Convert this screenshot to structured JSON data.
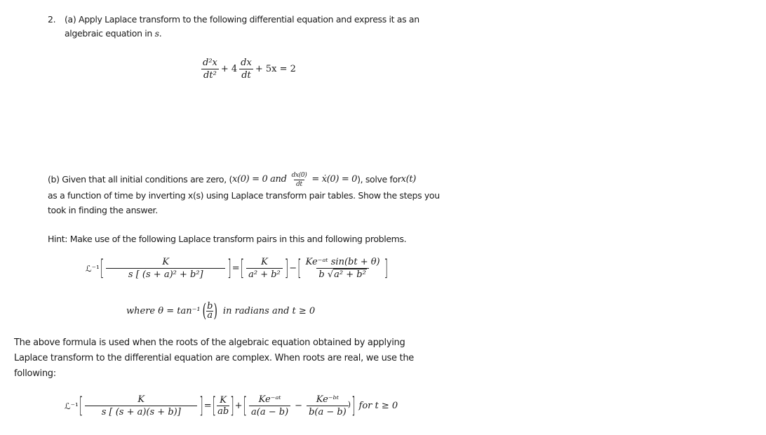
{
  "question": {
    "number": "2.",
    "part_a": {
      "line1": "(a) Apply Laplace transform to the following differential equation and express it as an",
      "line2_prefix": "algebraic equation in ",
      "line2_var": "s",
      "line2_suffix": "."
    },
    "differential_equation": {
      "term1_num": "d²x",
      "term1_den": "dt²",
      "plus1": "+ 4",
      "term2_num": "dx",
      "term2_den": "dt",
      "rest": "+ 5x = 2"
    },
    "part_b": {
      "line1_prefix": "(b) Given that all initial conditions are zero, (",
      "cond1": "x(0) = 0 and",
      "frac_num": "dx(0)",
      "frac_den": "dt",
      "cond2": "= ẋ(0) = 0",
      "line1_suffix": "), solve for ",
      "target": "x(t)",
      "line2": "as a function of time by inverting x(s) using Laplace transform pair tables. Show the steps you",
      "line3": "took in finding the answer."
    },
    "hint": "Hint: Make use of the following Laplace transform pairs in this and following problems.",
    "formula1": {
      "op": "ℒ⁻¹",
      "lhs_num": "K",
      "lhs_den": "s [ (s + a)² + b²]",
      "eq": "=",
      "t1_num": "K",
      "t1_den": "a² +  b²",
      "minus": "−",
      "t2_num": "Ke⁻ᵃᵗ sin(bt + θ)",
      "t2_den_b": "b",
      "t2_den_sqrt": "a² + b²"
    },
    "where_clause": {
      "prefix": "where θ = tan⁻¹",
      "frac_num": "b",
      "frac_den": "a",
      "suffix": "in radians and t ≥ 0"
    },
    "explanation": {
      "line1": "The above formula is used when the roots of the algebraic equation obtained by applying",
      "line2": "Laplace transform to the differential equation are complex. When roots are real, we use the",
      "line3": "following:"
    },
    "formula2": {
      "op": "ℒ⁻¹",
      "lhs_num": "K",
      "lhs_den": "s [ (s + a)(s + b)]",
      "eq": "=",
      "t1_num": "K",
      "t1_den": "ab",
      "plus": "+",
      "t2_num": "Ke⁻ᵃᵗ",
      "t2_den": "a(a − b)",
      "minus": "−",
      "t3_num": "Ke⁻ᵇᵗ",
      "t3_den": "b(a − b)",
      "close_paren": ")",
      "suffix": "for t ≥ 0"
    }
  }
}
